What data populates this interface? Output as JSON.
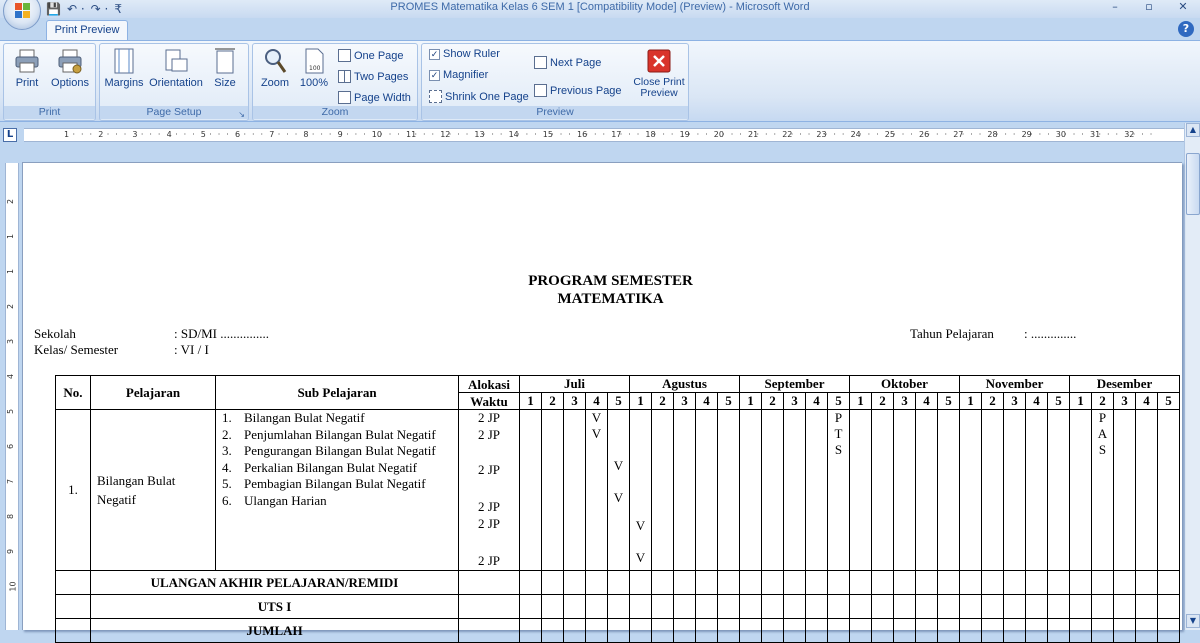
{
  "window": {
    "title": "PROMES Matematika Kelas 6 SEM 1 [Compatibility Mode] (Preview) - Microsoft Word",
    "minimize": "–",
    "maximize": "▫",
    "close": "✕"
  },
  "qat": {
    "save": "💾",
    "undo": "↶ ·",
    "redo": "↷ ·",
    "more": "₹"
  },
  "tabs": {
    "active": "Print Preview",
    "help": "?"
  },
  "ribbon": {
    "print_group": {
      "label": "Print",
      "print": "Print",
      "options": "Options"
    },
    "page_setup_group": {
      "label": "Page Setup",
      "margins": "Margins",
      "orientation": "Orientation",
      "size": "Size",
      "launcher": "↘"
    },
    "zoom_group": {
      "label": "Zoom",
      "zoom": "Zoom",
      "hundred": "100%",
      "one_page": "One Page",
      "two_pages": "Two Pages",
      "page_width": "Page Width"
    },
    "preview_group": {
      "label": "Preview",
      "show_ruler": "Show Ruler",
      "magnifier": "Magnifier",
      "shrink": "Shrink One Page",
      "next_page": "Next Page",
      "previous_page": "Previous Page",
      "close_line1": "Close Print",
      "close_line2": "Preview"
    }
  },
  "ruler": {
    "corner": "L",
    "numbers": [
      "1",
      "2",
      "3",
      "4",
      "5",
      "6",
      "7",
      "8",
      "9",
      "10",
      "11",
      "12",
      "13",
      "14",
      "15",
      "16",
      "17",
      "18",
      "19",
      "20",
      "21",
      "22",
      "23",
      "24",
      "25",
      "26",
      "27",
      "28",
      "29",
      "30",
      "31",
      "32"
    ],
    "v_numbers": [
      "2",
      "1",
      "1",
      "2",
      "3",
      "4",
      "5",
      "6",
      "7",
      "8",
      "9",
      "10"
    ]
  },
  "doc": {
    "title1": "PROGRAM SEMESTER",
    "title2": "MATEMATIKA",
    "sekolah_label": "Sekolah",
    "sekolah_value": ": SD/MI ...............",
    "kelas_label": "Kelas/ Semester",
    "kelas_value": ": VI / I",
    "tahun_label": "Tahun Pelajaran",
    "tahun_value": ": ..............",
    "headers": {
      "no": "No.",
      "pelajaran": "Pelajaran",
      "sub": "Sub Pelajaran",
      "alokasi1": "Alokasi",
      "alokasi2": "Waktu"
    },
    "months": [
      "Juli",
      "Agustus",
      "September",
      "Oktober",
      "November",
      "Desember"
    ],
    "weeks": [
      "1",
      "2",
      "3",
      "4",
      "5"
    ],
    "row1": {
      "no": "1.",
      "pelajaran": "Bilangan Bulat Negatif",
      "subs": [
        {
          "n": "1.",
          "t": "Bilangan Bulat Negatif"
        },
        {
          "n": "2.",
          "t": "Penjumlahan Bilangan Bulat Negatif"
        },
        {
          "n": "3.",
          "t": "Pengurangan Bilangan Bulat Negatif"
        },
        {
          "n": "4.",
          "t": "Perkalian Bilangan Bulat Negatif"
        },
        {
          "n": "5.",
          "t": "Pembagian Bilangan Bulat Negatif"
        },
        {
          "n": "6.",
          "t": "Ulangan Harian"
        }
      ],
      "jp": [
        "2 JP",
        "2 JP",
        "2 JP",
        "2 JP",
        "2 JP",
        "2 JP"
      ],
      "mark": "V",
      "pts": [
        "P",
        "T",
        "S"
      ],
      "pas": [
        "P",
        "A",
        "S"
      ]
    },
    "row_ulangan": "ULANGAN AKHIR PELAJARAN/REMIDI",
    "row_uts": "UTS  I",
    "row_jumlah": "JUMLAH"
  }
}
